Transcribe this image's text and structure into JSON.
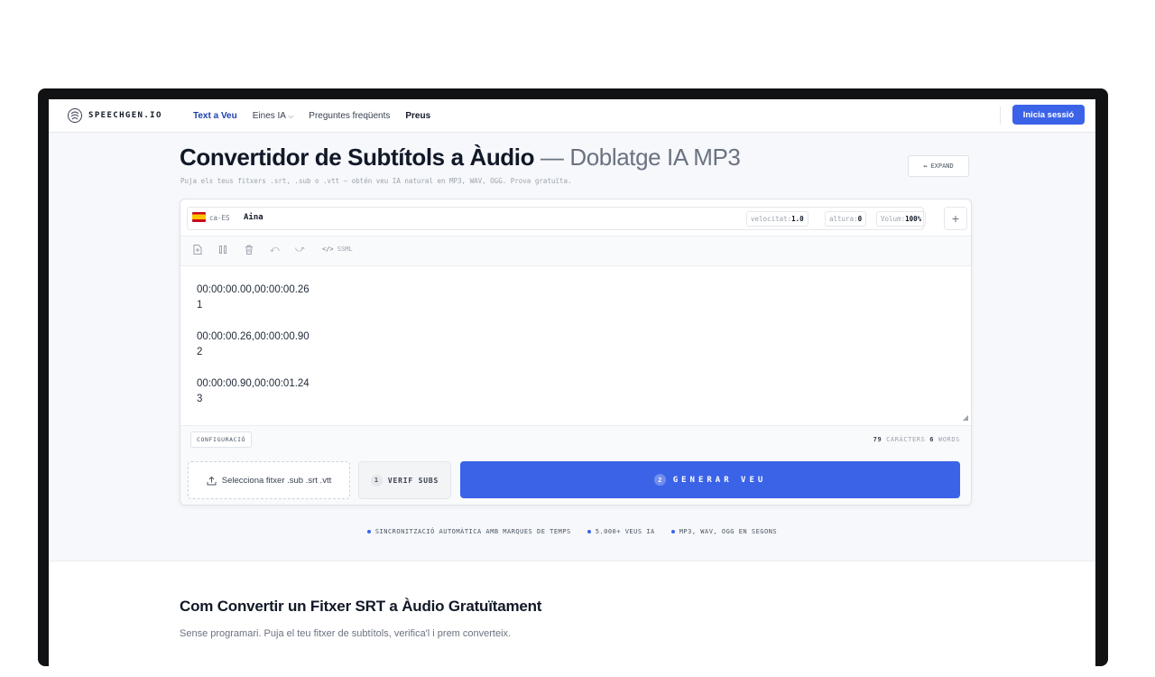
{
  "nav": {
    "logo": "SPEECHGEN.IO",
    "links": [
      "Text a Veu",
      "Eines IA",
      "Preguntes freqüents",
      "Preus"
    ],
    "login": "Inicia sessió"
  },
  "hero": {
    "title_main": "Convertidor de Subtítols a Àudio",
    "title_sub": " — Doblatge IA MP3",
    "subtitle": "Puja els teus fitxers .srt, .sub o .vtt — obtén veu IA natural en MP3, WAV, OGG. Prova gratuïta.",
    "expand": "EXPAND"
  },
  "editor": {
    "lang": "ca-ES",
    "voice": "Aina",
    "speed_label": "velocitat:",
    "speed": "1.0",
    "pitch_label": "altura:",
    "pitch": "0",
    "volume_label": "Volum:",
    "volume": "100%",
    "ssml": "SSML",
    "lines": [
      "00:00:00.00,00:00:00.26",
      "1",
      "00:00:00.26,00:00:00.90",
      "2",
      "00:00:00.90,00:00:01.24",
      "3"
    ],
    "config": "CONFIGURACIÓ",
    "char_count": "79",
    "char_label": "CARÀCTERS",
    "word_count": "6",
    "word_label": "WORDS",
    "file_button": "Selecciona fitxer .sub .srt .vtt",
    "verif_step": "1",
    "verif_button": "VERIF SUBS",
    "gen_step": "2",
    "gen_button": "GENERAR VEU"
  },
  "features": [
    "SINCRONITZACIÓ AUTOMÀTICA AMB MARQUES DE TEMPS",
    "5.000+ VEUS IA",
    "MP3, WAV, OGG EN SEGONS"
  ],
  "section": {
    "title": "Com Convertir un Fitxer SRT a Àudio Gratuïtament",
    "text": "Sense programari. Puja el teu fitxer de subtítols, verifica'l i prem converteix."
  },
  "colors": {
    "accent": "#3b63e8",
    "nav_active": "#1e40af"
  }
}
